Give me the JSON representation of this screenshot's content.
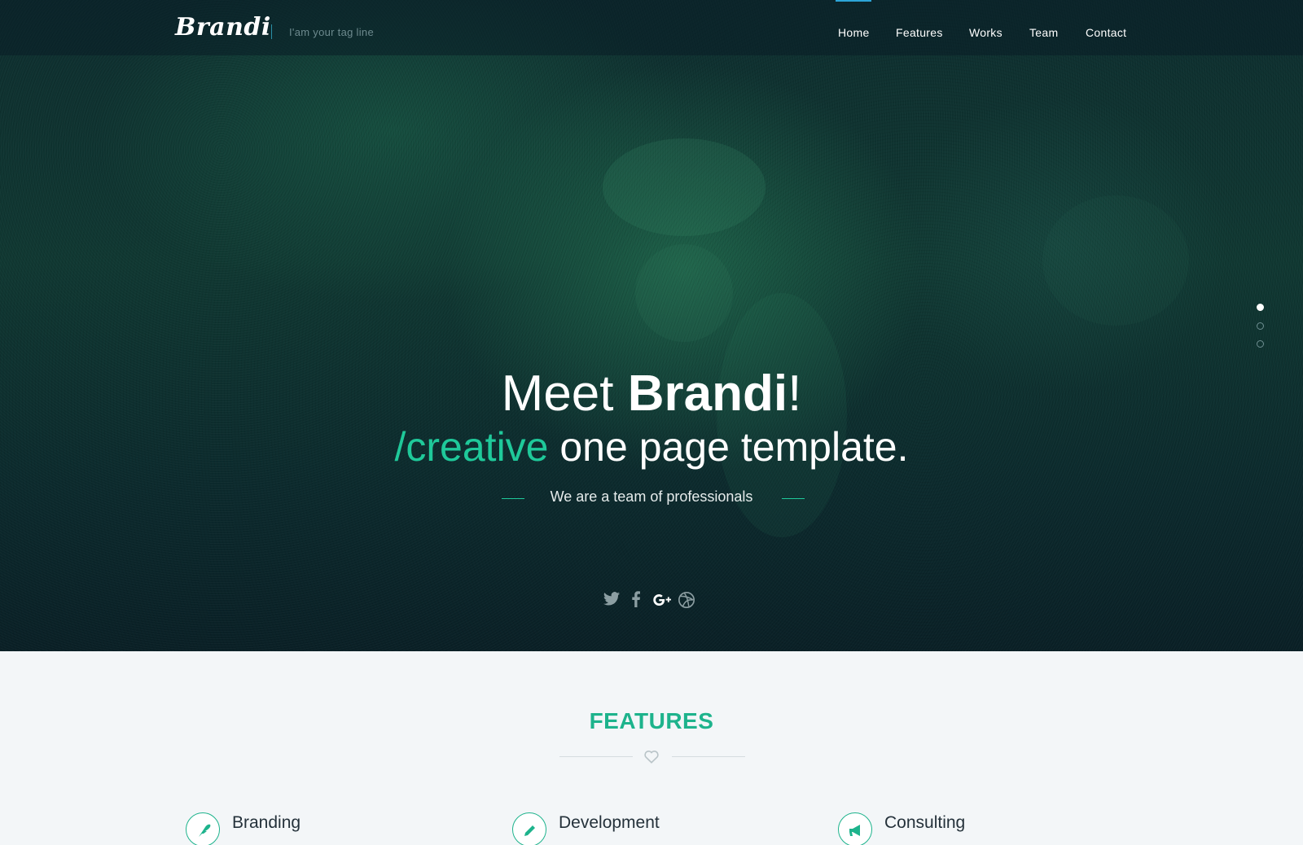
{
  "header": {
    "logo": "Brandi",
    "tagline": "I'am your tag line",
    "nav": [
      "Home",
      "Features",
      "Works",
      "Team",
      "Contact"
    ],
    "active_nav": "Home"
  },
  "hero": {
    "title_pre": "Meet ",
    "title_bold": "Brandi",
    "title_post": "!",
    "subtitle_accent": "/creative",
    "subtitle_rest": " one page template.",
    "tagline": "We are a team of professionals",
    "social_icons": [
      "twitter-icon",
      "facebook-icon",
      "google-plus-icon",
      "dribbble-icon"
    ],
    "slide_count": 3,
    "active_slide": 1
  },
  "features": {
    "title": "FEATURES",
    "items": [
      {
        "label": "Branding",
        "icon": "feather-icon"
      },
      {
        "label": "Development",
        "icon": "pencil-icon"
      },
      {
        "label": "Consulting",
        "icon": "megaphone-icon"
      }
    ]
  },
  "colors": {
    "accent": "#1db38c",
    "hero_accent": "#1fc99a",
    "nav_active": "#2ca5d8"
  }
}
